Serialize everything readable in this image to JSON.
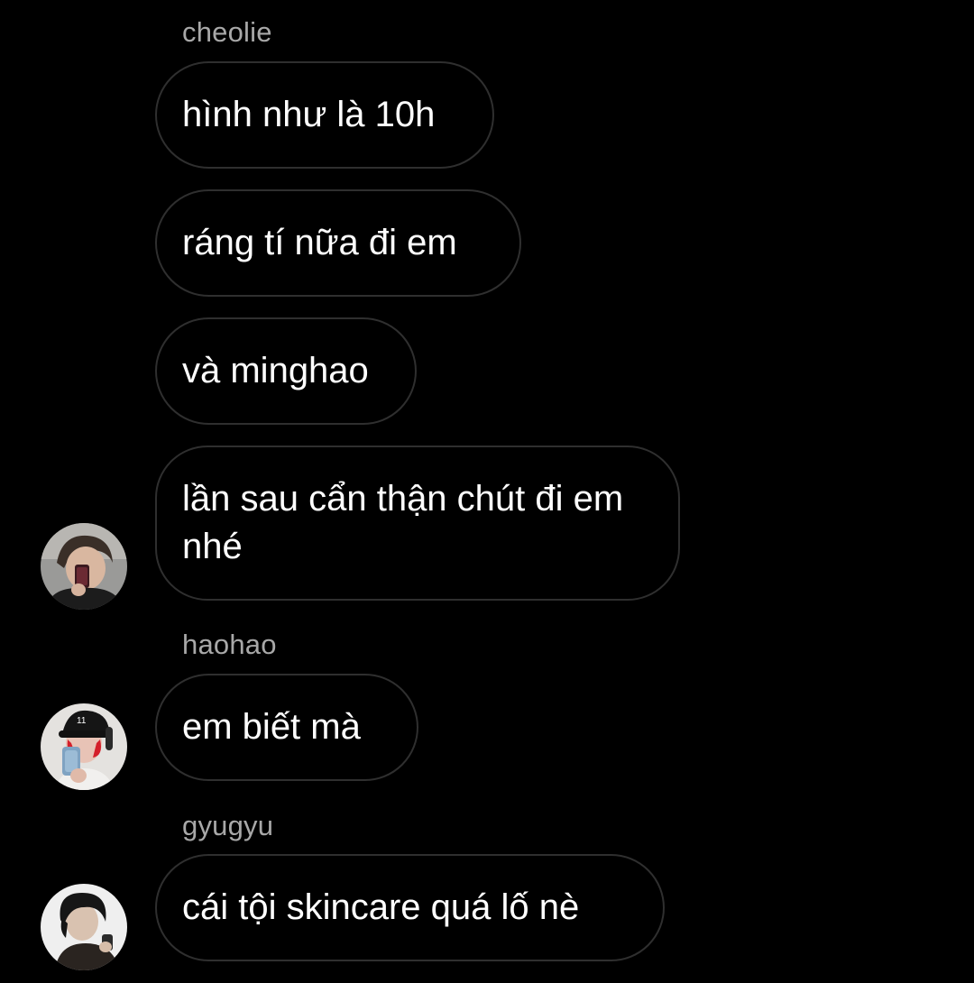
{
  "chat": {
    "groups": [
      {
        "sender": "cheolie",
        "messages": [
          "hình như là 10h",
          "ráng tí nữa đi em",
          "và minghao",
          "lần sau cẩn thận chút đi em nhé"
        ],
        "avatar_icon": "user-avatar-icon"
      },
      {
        "sender": "haohao",
        "messages": [
          "em biết mà"
        ],
        "avatar_icon": "user-avatar-icon"
      },
      {
        "sender": "gyugyu",
        "messages": [
          "cái tội skincare quá lố nè"
        ],
        "avatar_icon": "user-avatar-icon"
      }
    ]
  },
  "colors": {
    "background": "#000000",
    "bubble_border": "#2f2f2f",
    "text": "#ffffff",
    "sender_name": "#a8a8a8"
  }
}
